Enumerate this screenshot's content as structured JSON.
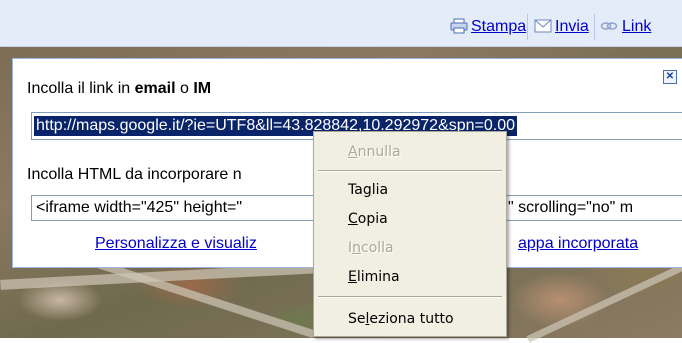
{
  "toolbar": {
    "print_label": "Stampa",
    "send_label": "Invia",
    "link_label": "Link",
    "print_icon": "printer-icon",
    "send_icon": "envelope-icon",
    "link_icon": "chain-link-icon"
  },
  "share_panel": {
    "email_label_prefix": "Incolla il link in ",
    "email_label_bold1": "email",
    "email_label_mid": " o ",
    "email_label_bold2": "IM",
    "link_value": "http://maps.google.it/?ie=UTF8&ll=43.828842,10.292972&spn=0.00",
    "html_label": "Incolla HTML da incorporare n",
    "html_value": "<iframe width=\"425\" height=\"",
    "html_value_tail": "\" scrolling=\"no\" m",
    "customize_link_start": "Personalizza e visualiz",
    "customize_link_end": "appa incorporata",
    "close_icon": "close-x-icon"
  },
  "context_menu": {
    "items": [
      {
        "label_pre": "",
        "label_ul": "A",
        "label_post": "nnulla",
        "enabled": false
      },
      {
        "label_pre": "Ta",
        "label_ul": "g",
        "label_post": "lia",
        "enabled": true
      },
      {
        "label_pre": "",
        "label_ul": "C",
        "label_post": "opia",
        "enabled": true
      },
      {
        "label_pre": "I",
        "label_ul": "n",
        "label_post": "colla",
        "enabled": false
      },
      {
        "label_pre": "",
        "label_ul": "E",
        "label_post": "limina",
        "enabled": true
      },
      {
        "label_pre": "Se",
        "label_ul": "l",
        "label_post": "eziona tutto",
        "enabled": true
      }
    ]
  },
  "colors": {
    "toolbar_bg": "#e5ecf9",
    "link_blue": "#0000cc",
    "selection_bg": "#0a246a",
    "menu_bg": "#f1efe2"
  }
}
